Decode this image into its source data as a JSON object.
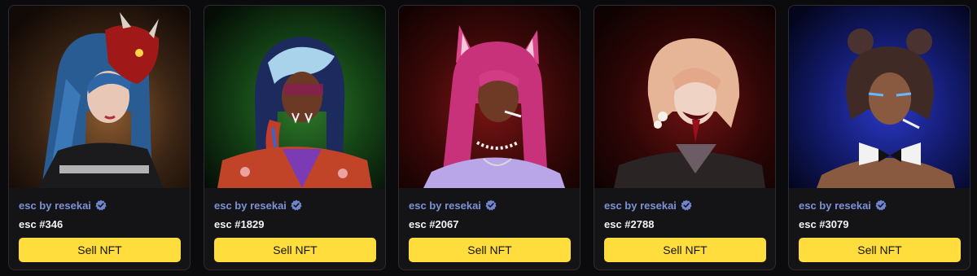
{
  "colors": {
    "page_background": "#0b0b0d",
    "card_background": "#141417",
    "collection_link": "#7d92d6",
    "verified_badge": "#6f86cf",
    "sell_button": "#ffdd3c"
  },
  "cards": [
    {
      "collection": "esc by resekai",
      "verified_icon": "verified-badge-icon",
      "token": "esc #346",
      "action": "Sell NFT",
      "art": {
        "description_icon": "nft-portrait-blue-hair-oni-mask",
        "bg": "#6b4a2c"
      }
    },
    {
      "collection": "esc by resekai",
      "verified_icon": "verified-badge-icon",
      "token": "esc #1829",
      "action": "Sell NFT",
      "art": {
        "description_icon": "nft-portrait-white-blue-hair-fangs",
        "bg": "#1d4a1d"
      }
    },
    {
      "collection": "esc by resekai",
      "verified_icon": "verified-badge-icon",
      "token": "esc #2067",
      "action": "Sell NFT",
      "art": {
        "description_icon": "nft-portrait-pink-hair-cat-ears",
        "bg": "#5a1010"
      }
    },
    {
      "collection": "esc by resekai",
      "verified_icon": "verified-badge-icon",
      "token": "esc #2788",
      "action": "Sell NFT",
      "art": {
        "description_icon": "nft-portrait-peach-hair-open-mouth",
        "bg": "#4a0e0e"
      }
    },
    {
      "collection": "esc by resekai",
      "verified_icon": "verified-badge-icon",
      "token": "esc #3079",
      "action": "Sell NFT",
      "art": {
        "description_icon": "nft-portrait-brown-hair-bunny-suit",
        "bg": "#141d6e"
      }
    }
  ]
}
